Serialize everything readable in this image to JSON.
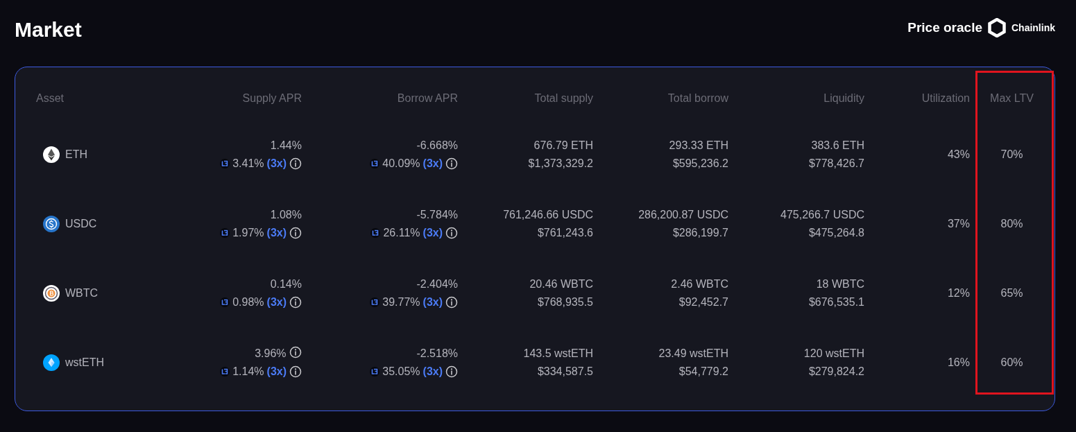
{
  "title": "Market",
  "oracle": {
    "label": "Price oracle",
    "provider": "Chainlink"
  },
  "table": {
    "columns": [
      {
        "label": "Asset",
        "highlighted": false
      },
      {
        "label": "Supply APR",
        "highlighted": false
      },
      {
        "label": "Borrow APR",
        "highlighted": false
      },
      {
        "label": "Total supply",
        "highlighted": false
      },
      {
        "label": "Total borrow",
        "highlighted": false
      },
      {
        "label": "Liquidity",
        "highlighted": false
      },
      {
        "label": "Utilization",
        "highlighted": false
      },
      {
        "label": "Max LTV",
        "highlighted": true
      }
    ],
    "rows": [
      {
        "asset": "ETH",
        "kind": "eth",
        "supply_apr": {
          "value": "1.44%",
          "info": false,
          "boosted": "3.41%",
          "multiplier": "(3x)"
        },
        "borrow_apr": {
          "value": "-6.668%",
          "boosted": "40.09%",
          "multiplier": "(3x)"
        },
        "total_supply": [
          "676.79 ETH",
          "$1,373,329.2"
        ],
        "total_borrow": [
          "293.33 ETH",
          "$595,236.2"
        ],
        "liquidity": [
          "383.6 ETH",
          "$778,426.7"
        ],
        "utilization": "43%",
        "max_ltv": "70%"
      },
      {
        "asset": "USDC",
        "kind": "usdc",
        "supply_apr": {
          "value": "1.08%",
          "info": false,
          "boosted": "1.97%",
          "multiplier": "(3x)"
        },
        "borrow_apr": {
          "value": "-5.784%",
          "boosted": "26.11%",
          "multiplier": "(3x)"
        },
        "total_supply": [
          "761,246.66 USDC",
          "$761,243.6"
        ],
        "total_borrow": [
          "286,200.87 USDC",
          "$286,199.7"
        ],
        "liquidity": [
          "475,266.7 USDC",
          "$475,264.8"
        ],
        "utilization": "37%",
        "max_ltv": "80%"
      },
      {
        "asset": "WBTC",
        "kind": "wbtc",
        "supply_apr": {
          "value": "0.14%",
          "info": false,
          "boosted": "0.98%",
          "multiplier": "(3x)"
        },
        "borrow_apr": {
          "value": "-2.404%",
          "boosted": "39.77%",
          "multiplier": "(3x)"
        },
        "total_supply": [
          "20.46 WBTC",
          "$768,935.5"
        ],
        "total_borrow": [
          "2.46 WBTC",
          "$92,452.7"
        ],
        "liquidity": [
          "18 WBTC",
          "$676,535.1"
        ],
        "utilization": "12%",
        "max_ltv": "65%"
      },
      {
        "asset": "wstETH",
        "kind": "wsteth",
        "supply_apr": {
          "value": "3.96%",
          "info": true,
          "boosted": "1.14%",
          "multiplier": "(3x)"
        },
        "borrow_apr": {
          "value": "-2.518%",
          "boosted": "35.05%",
          "multiplier": "(3x)"
        },
        "total_supply": [
          "143.5 wstETH",
          "$334,587.5"
        ],
        "total_borrow": [
          "23.49 wstETH",
          "$54,779.2"
        ],
        "liquidity": [
          "120 wstETH",
          "$279,824.2"
        ],
        "utilization": "16%",
        "max_ltv": "60%"
      }
    ]
  }
}
